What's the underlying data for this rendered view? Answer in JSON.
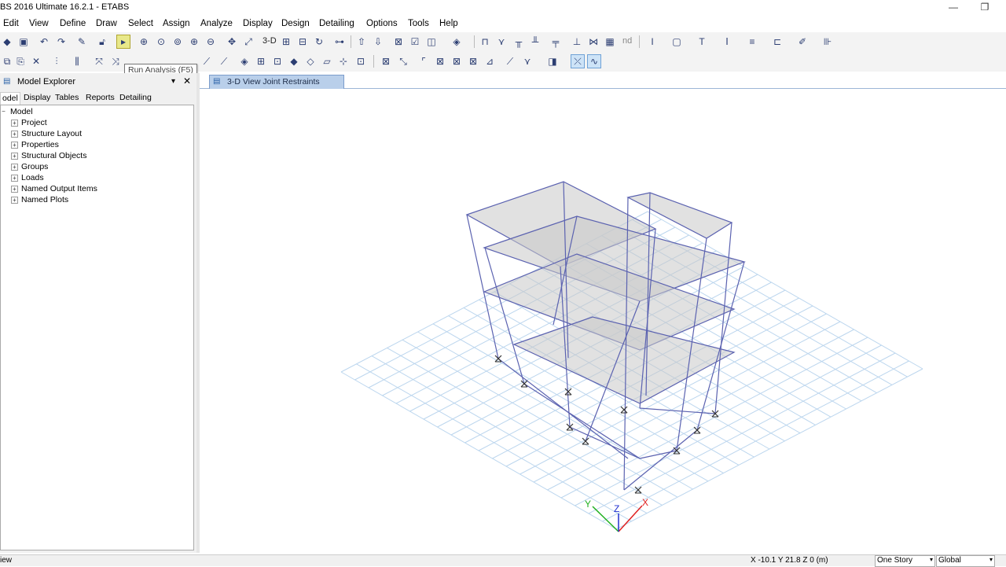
{
  "app": {
    "title": "BS 2016 Ultimate 16.2.1 - ETABS",
    "minimize_glyph": "—",
    "restore_glyph": "❐"
  },
  "menu": [
    "Edit",
    "View",
    "Define",
    "Draw",
    "Select",
    "Assign",
    "Analyze",
    "Display",
    "Design",
    "Detailing",
    "Options",
    "Tools",
    "Help"
  ],
  "toolbar": {
    "view_3d_label": "3-D",
    "nd_label": "nd",
    "tooltip": "Run Analysis (F5)"
  },
  "explorer": {
    "title": "Model Explorer",
    "close_glyph": "✕",
    "pin_glyph": "▾",
    "tabs": [
      "odel",
      "Display",
      "Tables",
      "Reports",
      "Detailing"
    ],
    "active_tab": "odel",
    "root": {
      "label": "Model",
      "expander": "−"
    },
    "items": [
      {
        "label": "Project",
        "expander": "+"
      },
      {
        "label": "Structure Layout",
        "expander": "+"
      },
      {
        "label": "Properties",
        "expander": "+"
      },
      {
        "label": "Structural Objects",
        "expander": "+"
      },
      {
        "label": "Groups",
        "expander": "+"
      },
      {
        "label": "Loads",
        "expander": "+"
      },
      {
        "label": "Named Output Items",
        "expander": "+"
      },
      {
        "label": "Named Plots",
        "expander": "+"
      }
    ]
  },
  "view": {
    "tab_label": "3-D View  Joint Restraints",
    "axes": {
      "x": "X",
      "y": "Y",
      "z": "Z"
    },
    "colors": {
      "grid": "#bcd6ee",
      "frame": "#5b62b0",
      "slab_fill": "#c8c8c8",
      "axis_x": "#e02020",
      "axis_y": "#20b020",
      "axis_z": "#2030d0"
    }
  },
  "status": {
    "left": "iew",
    "coords": "X -10.1  Y 21.8  Z 0 (m)",
    "story": "One Story",
    "coord_system": "Global",
    "combo_arrow": "▾"
  }
}
